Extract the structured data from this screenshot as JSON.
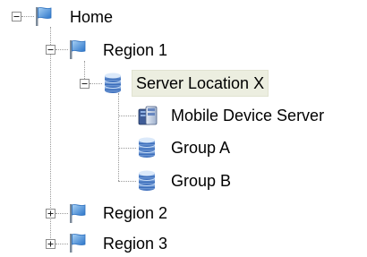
{
  "tree": {
    "home": {
      "label": "Home",
      "icon": "flag-icon",
      "state": "expanded"
    },
    "region1": {
      "label": "Region 1",
      "icon": "flag-icon",
      "state": "expanded"
    },
    "server_location": {
      "label": "Server Location X",
      "icon": "server-stack-icon",
      "state": "expanded",
      "selected": true
    },
    "mobile_device_server": {
      "label": "Mobile Device Server",
      "icon": "server-icon"
    },
    "group_a": {
      "label": "Group A",
      "icon": "server-group-icon"
    },
    "group_b": {
      "label": "Group B",
      "icon": "server-group-icon"
    },
    "region2": {
      "label": "Region 2",
      "icon": "flag-icon",
      "state": "collapsed"
    },
    "region3": {
      "label": "Region 3",
      "icon": "flag-icon",
      "state": "collapsed"
    }
  },
  "colors": {
    "flag": "#3b84d4",
    "server": "#4a73b8",
    "selected_background": "#eceee0"
  }
}
